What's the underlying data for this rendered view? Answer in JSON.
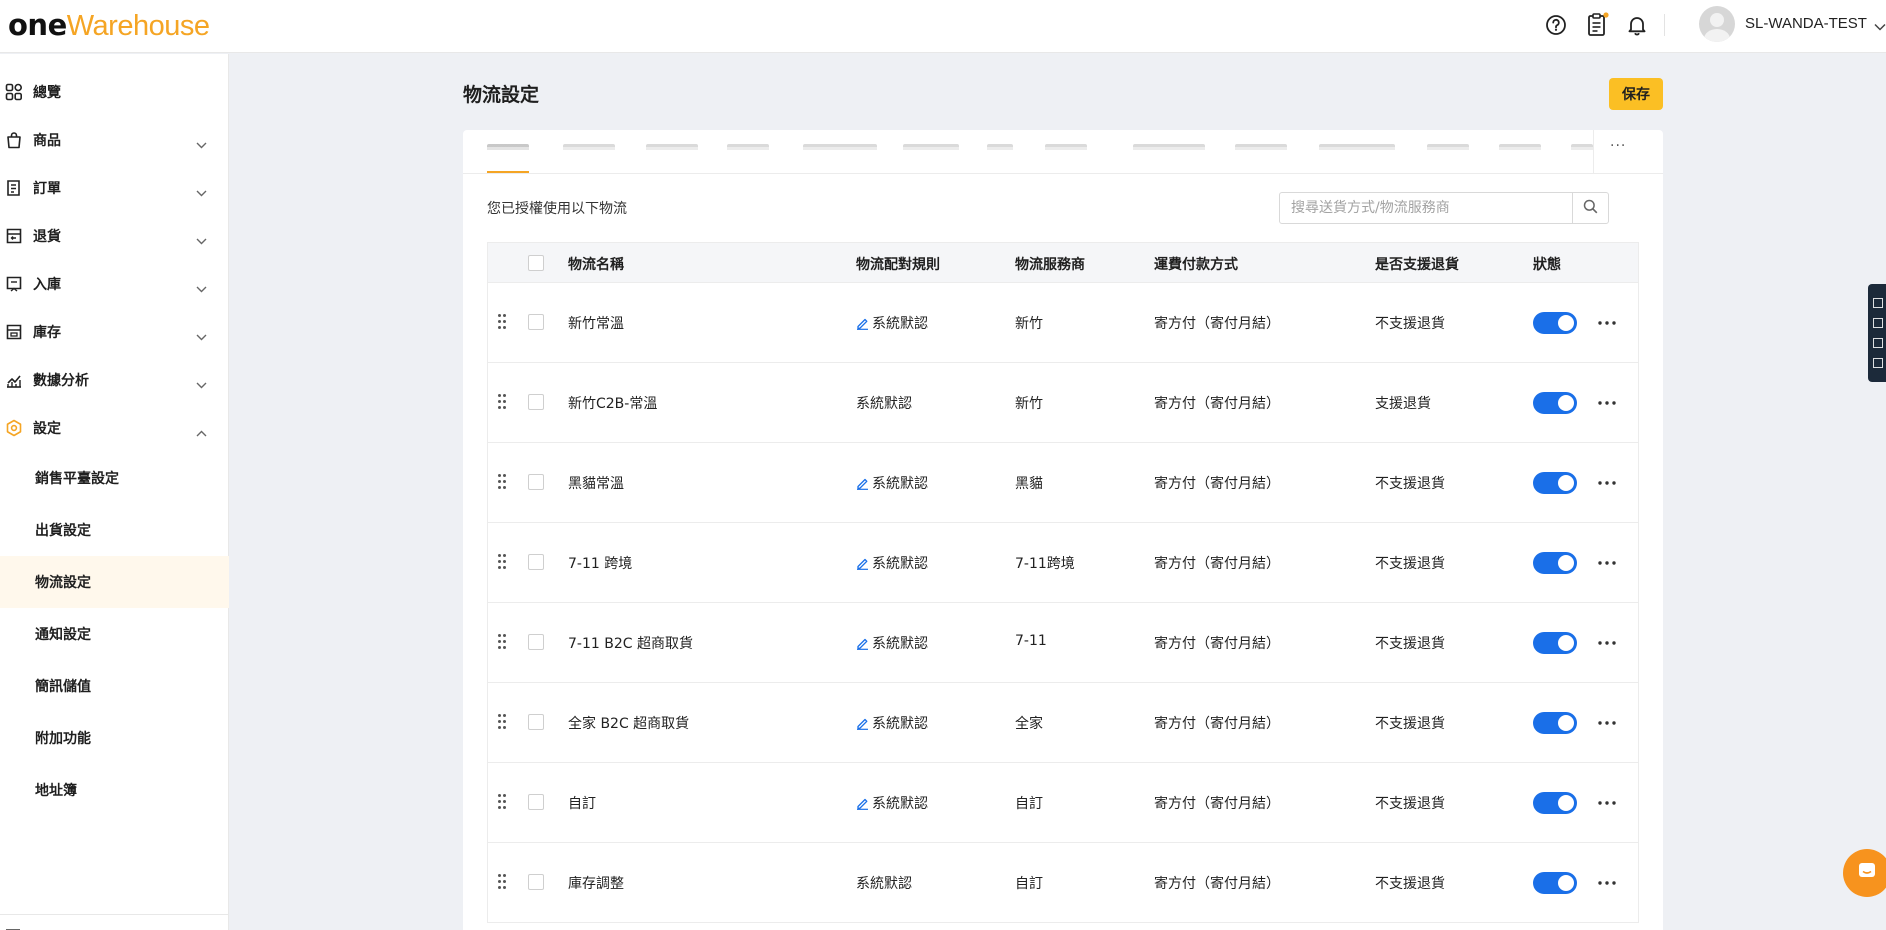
{
  "header": {
    "logo_one": "one",
    "logo_warehouse": "Warehouse",
    "username": "SL-WANDA-TEST"
  },
  "sidebar": {
    "items": [
      {
        "label": "總覽",
        "icon": "dashboard-icon",
        "expandable": false
      },
      {
        "label": "商品",
        "icon": "shopping-bag-icon",
        "expandable": true
      },
      {
        "label": "訂單",
        "icon": "order-icon",
        "expandable": true
      },
      {
        "label": "退貨",
        "icon": "return-icon",
        "expandable": true
      },
      {
        "label": "入庫",
        "icon": "inbound-icon",
        "expandable": true
      },
      {
        "label": "庫存",
        "icon": "inventory-icon",
        "expandable": true
      },
      {
        "label": "數據分析",
        "icon": "analytics-icon",
        "expandable": true
      },
      {
        "label": "設定",
        "icon": "settings-icon",
        "expandable": true,
        "expanded": true
      }
    ],
    "sub_items": [
      {
        "label": "銷售平臺設定"
      },
      {
        "label": "出貨設定"
      },
      {
        "label": "物流設定",
        "selected": true
      },
      {
        "label": "通知設定"
      },
      {
        "label": "簡訊儲值"
      },
      {
        "label": "附加功能"
      },
      {
        "label": "地址簿"
      }
    ]
  },
  "page": {
    "title": "物流設定",
    "save_label": "保存",
    "authorized_text": "您已授權使用以下物流",
    "search_placeholder": "搜尋送貨方式/物流服務商"
  },
  "table": {
    "columns": [
      "物流名稱",
      "物流配對規則",
      "物流服務商",
      "運費付款方式",
      "是否支援退貨",
      "狀態"
    ],
    "rows": [
      {
        "name": "新竹常溫",
        "rule": "系統默認",
        "rule_editable": true,
        "provider": "新竹",
        "payment": "寄方付（寄付月結）",
        "returns": "不支援退貨",
        "enabled": true
      },
      {
        "name": "新竹C2B-常溫",
        "rule": "系統默認",
        "rule_editable": false,
        "provider": "新竹",
        "payment": "寄方付（寄付月結）",
        "returns": "支援退貨",
        "enabled": true
      },
      {
        "name": "黑貓常溫",
        "rule": "系統默認",
        "rule_editable": true,
        "provider": "黑貓",
        "payment": "寄方付（寄付月結）",
        "returns": "不支援退貨",
        "enabled": true
      },
      {
        "name": "7-11 跨境",
        "rule": "系統默認",
        "rule_editable": true,
        "provider": "7-11跨境",
        "payment": "寄方付（寄付月結）",
        "returns": "不支援退貨",
        "enabled": true
      },
      {
        "name": "7-11 B2C 超商取貨",
        "rule": "系統默認",
        "rule_editable": true,
        "provider": "7-11",
        "payment": "寄方付（寄付月結）",
        "returns": "不支援退貨",
        "enabled": true
      },
      {
        "name": "全家 B2C 超商取貨",
        "rule": "系統默認",
        "rule_editable": true,
        "provider": "全家",
        "payment": "寄方付（寄付月結）",
        "returns": "不支援退貨",
        "enabled": true
      },
      {
        "name": "自訂",
        "rule": "系統默認",
        "rule_editable": true,
        "provider": "自訂",
        "payment": "寄方付（寄付月結）",
        "returns": "不支援退貨",
        "enabled": true
      },
      {
        "name": "庫存調整",
        "rule": "系統默認",
        "rule_editable": false,
        "provider": "自訂",
        "payment": "寄方付（寄付月結）",
        "returns": "不支援退貨",
        "enabled": true
      }
    ]
  },
  "colors": {
    "brand_accent": "#f5a524",
    "save_button": "#fbbf24",
    "toggle_on": "#1a6fe8",
    "selected_nav_bg": "#fff8ec",
    "chat_button": "#f7931e"
  }
}
